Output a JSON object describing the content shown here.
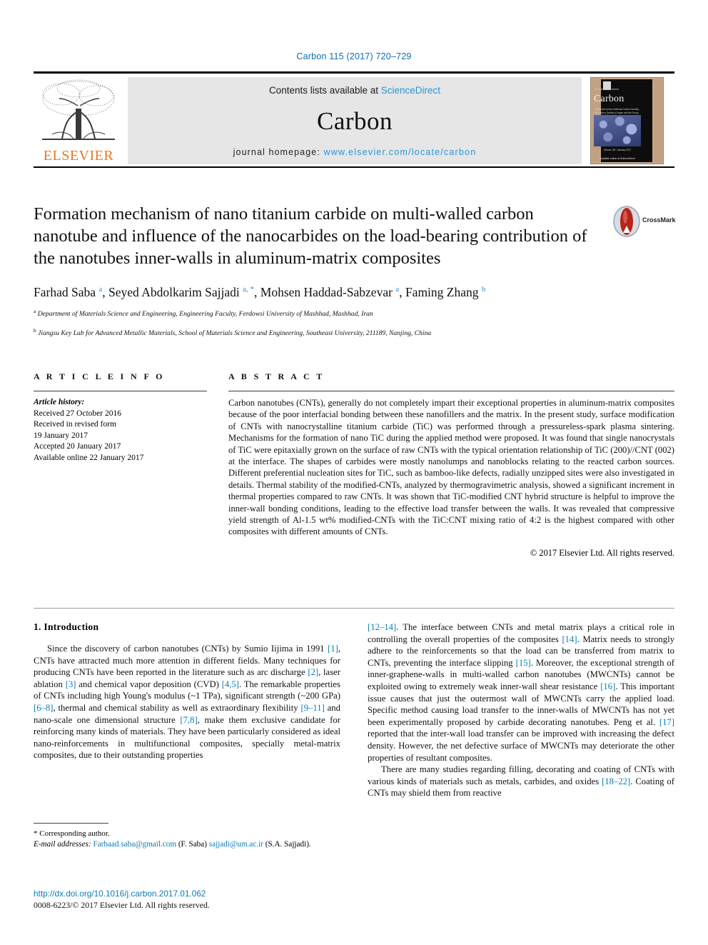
{
  "running_head": "Carbon 115 (2017) 720–729",
  "header": {
    "publisher_logo_label": "ELSEVIER",
    "contents_prefix": "Contents lists available at ",
    "contents_link": "ScienceDirect",
    "journal_name": "Carbon",
    "homepage_prefix": "journal homepage: ",
    "homepage_url": "www.elsevier.com/locate/carbon",
    "cover": {
      "title": "Carbon",
      "top_line": "An International Journal",
      "subtitle": "Sponsored by the American Carbon Society, the Carbon Society of Japan and the Group of Spanish Carbonists",
      "volume_line": "Volume 115 / January 2017",
      "footer_line": "Available online at",
      "footer_brand": "ScienceDirect"
    }
  },
  "article": {
    "title": "Formation mechanism of nano titanium carbide on multi-walled carbon nanotube and influence of the nanocarbides on the load-bearing contribution of the nanotubes inner-walls in aluminum-matrix composites",
    "crossmark_label": "CrossMark",
    "authors_html": "Farhad Saba <sup class=\"aff-mark\">a</sup>, Seyed Abdolkarim Sajjadi <sup class=\"aff-mark\">a, *</sup>, Mohsen Haddad-Sabzevar <sup class=\"aff-mark\">a</sup>, Faming Zhang <sup class=\"aff-mark\">b</sup>",
    "affiliations": [
      {
        "mark": "a",
        "text": "Department of Materials Science and Engineering, Engineering Faculty, Ferdowsi University of Mashhad, Mashhad, Iran"
      },
      {
        "mark": "b",
        "text": "Jiangsu Key Lab for Advanced Metallic Materials, School of Materials Science and Engineering, Southeast University, 211189, Nanjing, China"
      }
    ]
  },
  "article_info": {
    "heading": "A R T I C L E   I N F O",
    "history_label": "Article history:",
    "history_lines": [
      "Received 27 October 2016",
      "Received in revised form",
      "19 January 2017",
      "Accepted 20 January 2017",
      "Available online 22 January 2017"
    ]
  },
  "abstract": {
    "heading": "A B S T R A C T",
    "text": "Carbon nanotubes (CNTs), generally do not completely impart their exceptional properties in aluminum-matrix composites because of the poor interfacial bonding between these nanofillers and the matrix. In the present study, surface modification of CNTs with nanocrystalline titanium carbide (TiC) was performed through a pressureless-spark plasma sintering. Mechanisms for the formation of nano TiC during the applied method were proposed. It was found that single nanocrystals of TiC were epitaxially grown on the surface of raw CNTs with the typical orientation relationship of TiC (200)//CNT (002) at the interface. The shapes of carbides were mostly nanolumps and nanoblocks relating to the reacted carbon sources. Different preferential nucleation sites for TiC, such as bamboo-like defects, radially unzipped sites were also investigated in details. Thermal stability of the modified-CNTs, analyzed by thermogravimetric analysis, showed a significant increment in thermal properties compared to raw CNTs. It was shown that TiC-modified CNT hybrid structure is helpful to improve the inner-wall bonding conditions, leading to the effective load transfer between the walls. It was revealed that compressive yield strength of Al-1.5 wt% modified-CNTs with the TiC:CNT mixing ratio of 4:2 is the highest compared with other composites with different amounts of CNTs.",
    "copyright": "© 2017 Elsevier Ltd. All rights reserved."
  },
  "introduction": {
    "heading": "1. Introduction",
    "left_paragraph_html": "Since the discovery of carbon nanotubes (CNTs) by Sumio Iijima in 1991 <span class=\"ref\">[1]</span>, CNTs have attracted much more attention in different fields. Many techniques for producing CNTs have been reported in the literature such as arc discharge <span class=\"ref\">[2]</span>, laser ablation <span class=\"ref\">[3]</span> and chemical vapor deposition (CVD) <span class=\"ref\">[4,5]</span>. The remarkable properties of CNTs including high Young's modulus (~1 TPa), significant strength (~200 GPa) <span class=\"ref\">[6–8]</span>, thermal and chemical stability as well as extraordinary flexibility <span class=\"ref\">[9–11]</span> and nano-scale one dimensional structure <span class=\"ref\">[7,8]</span>, make them exclusive candidate for reinforcing many kinds of materials. They have been particularly considered as ideal nano-reinforcements in multifunctional composites, specially metal-matrix composites, due to their outstanding properties",
    "right_paragraph_1_html": "<span class=\"ref\">[12–14]</span>. The interface between CNTs and metal matrix plays a critical role in controlling the overall properties of the composites <span class=\"ref\">[14]</span>. Matrix needs to strongly adhere to the reinforcements so that the load can be transferred from matrix to CNTs, preventing the interface slipping <span class=\"ref\">[15]</span>. Moreover, the exceptional strength of inner-graphene-walls in multi-walled carbon nanotubes (MWCNTs) cannot be exploited owing to extremely weak inner-wall shear resistance <span class=\"ref\">[16]</span>. This important issue causes that just the outermost wall of MWCNTs carry the applied load. Specific method causing load transfer to the inner-walls of MWCNTs has not yet been experimentally proposed by carbide decorating nanotubes. Peng et al. <span class=\"ref\">[17]</span> reported that the inter-wall load transfer can be improved with increasing the defect density. However, the net defective surface of MWCNTs may deteriorate the other properties of resultant composites.",
    "right_paragraph_2_html": "There are many studies regarding filling, decorating and coating of CNTs with various kinds of materials such as metals, carbides, and oxides <span class=\"ref\">[18–22]</span>. Coating of CNTs may shield them from reactive"
  },
  "footnote": {
    "corresponding": "* Corresponding author.",
    "email_label": "E-mail addresses:",
    "email_1": "Farhaad.saba@gmail.com",
    "email_1_owner": "(F. Saba)",
    "email_2": "sajjadi@um.ac.ir",
    "email_2_owner": "(S.A. Sajjadi)."
  },
  "doi_block": {
    "doi": "http://dx.doi.org/10.1016/j.carbon.2017.01.062",
    "issn": "0008-6223/© 2017 Elsevier Ltd. All rights reserved."
  },
  "colors": {
    "link_blue": "#0b7cb5",
    "sciencedirect_blue": "#2a94d6",
    "elsevier_orange": "#e87722"
  }
}
